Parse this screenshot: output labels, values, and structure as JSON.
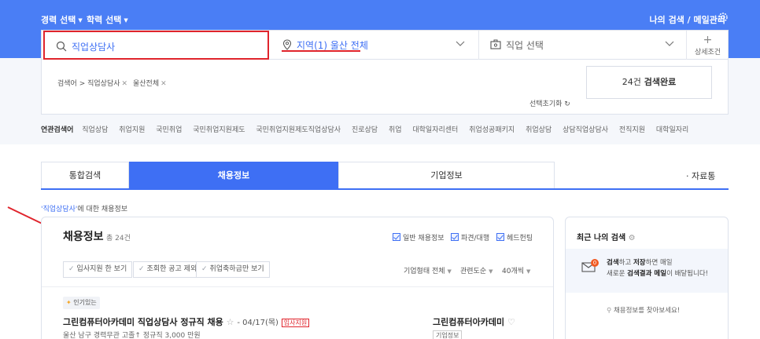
{
  "header": {
    "career_select": "경력 선택",
    "education_select": "학력 선택",
    "my_search": "나의 검색 / 메일관리"
  },
  "search": {
    "keyword": "직업상담사",
    "region": "지역(1) 울산 전체",
    "job_placeholder": "직업 선택",
    "detail_label": "상세조건"
  },
  "filters": {
    "chips": [
      "검색어 > 직업상담사",
      "울산전체"
    ],
    "reset_label": "선택초기화",
    "result_count": "24건",
    "result_label": "검색완료"
  },
  "related": {
    "heading": "연관검색어",
    "items": [
      "직업상담",
      "취업지원",
      "국민취업",
      "국민취업지원제도",
      "국민취업지원제도직업상담사",
      "진로상담",
      "취업",
      "대학일자리센터",
      "취업성공패키지",
      "취업상담",
      "상담직업상담사",
      "전직지원",
      "대학일자리"
    ]
  },
  "tabs": {
    "integrated": "통합검색",
    "jobs": "채용정보",
    "company": "기업정보",
    "data": "· 자료통"
  },
  "for_note": {
    "keyword": "'직업상담사'",
    "suffix": "에 대한 채용정보"
  },
  "main": {
    "title": "채용정보",
    "count": "총 24건",
    "checkboxes": [
      "일반 채용정보",
      "파견/대행",
      "헤드헌팅"
    ],
    "filter_chips": [
      "입사지원 한 보기",
      "조회한 공고 제외",
      "취업축하금만 보기"
    ],
    "sorts": [
      "기업형태 전체",
      "관련도순",
      "40개씩"
    ],
    "popular": "인기있는",
    "job": {
      "title": "그린컴퓨터아카데미 직업상담사 정규직 채용",
      "date": "- 04/17(목)",
      "badge": "입사지원",
      "meta": "울산 남구   경력무관   고졸↑   정규직   3,000 만원",
      "company": "그린컴퓨터아카데미",
      "company_tag": "기업정보"
    }
  },
  "side": {
    "title": "최근 나의 검색",
    "badge": "0",
    "line1_pre": "검색",
    "line1_mid1": "하고 ",
    "line1_bold2": "저장",
    "line1_post": "하면 매일",
    "line2_pre": "새로운 ",
    "line2_bold1": "검색결과",
    "line2_mid": " 메일",
    "line2_post": "이 배달됩니다!",
    "search_link": "채용정보를 찾아보세요!"
  },
  "colors": {
    "brand_blue": "#4a7ef5",
    "highlight_red": "#e0242c"
  }
}
